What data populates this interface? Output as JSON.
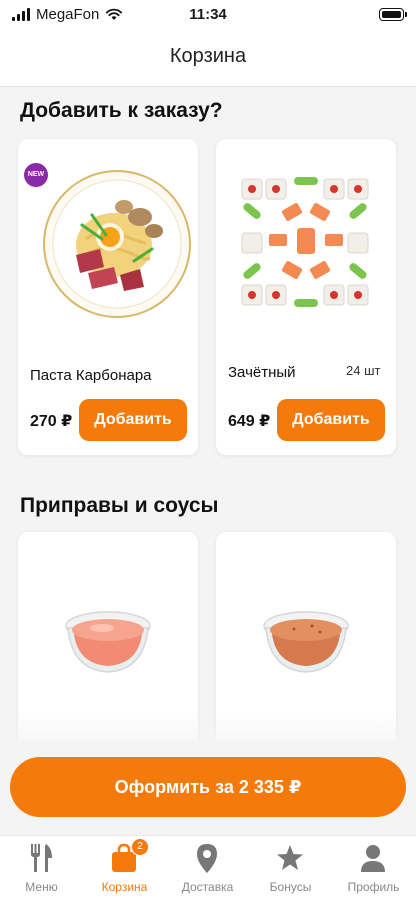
{
  "status_bar": {
    "carrier": "MegaFon",
    "time": "11:34"
  },
  "header": {
    "title": "Корзина"
  },
  "upsell": {
    "title": "Добавить к заказу?",
    "items": [
      {
        "name": "Паста Карбонара",
        "price": "270 ₽",
        "badge": "NEW",
        "add_label": "Добавить"
      },
      {
        "name": "Зачётный",
        "count": "24 шт",
        "price": "649 ₽",
        "add_label": "Добавить"
      }
    ]
  },
  "sauces": {
    "title": "Приправы и соусы"
  },
  "checkout": {
    "label": "Оформить за 2 335 ₽"
  },
  "tab_bar": {
    "items": [
      {
        "label": "Меню",
        "icon": "fork-knife-icon"
      },
      {
        "label": "Корзина",
        "icon": "bag-icon",
        "badge": "2",
        "active": true
      },
      {
        "label": "Доставка",
        "icon": "map-pin-icon"
      },
      {
        "label": "Бонусы",
        "icon": "star-icon"
      },
      {
        "label": "Профиль",
        "icon": "user-icon"
      }
    ]
  },
  "colors": {
    "accent": "#f47a0c",
    "new_badge": "#8b2aa8",
    "inactive_tab": "#888888"
  }
}
